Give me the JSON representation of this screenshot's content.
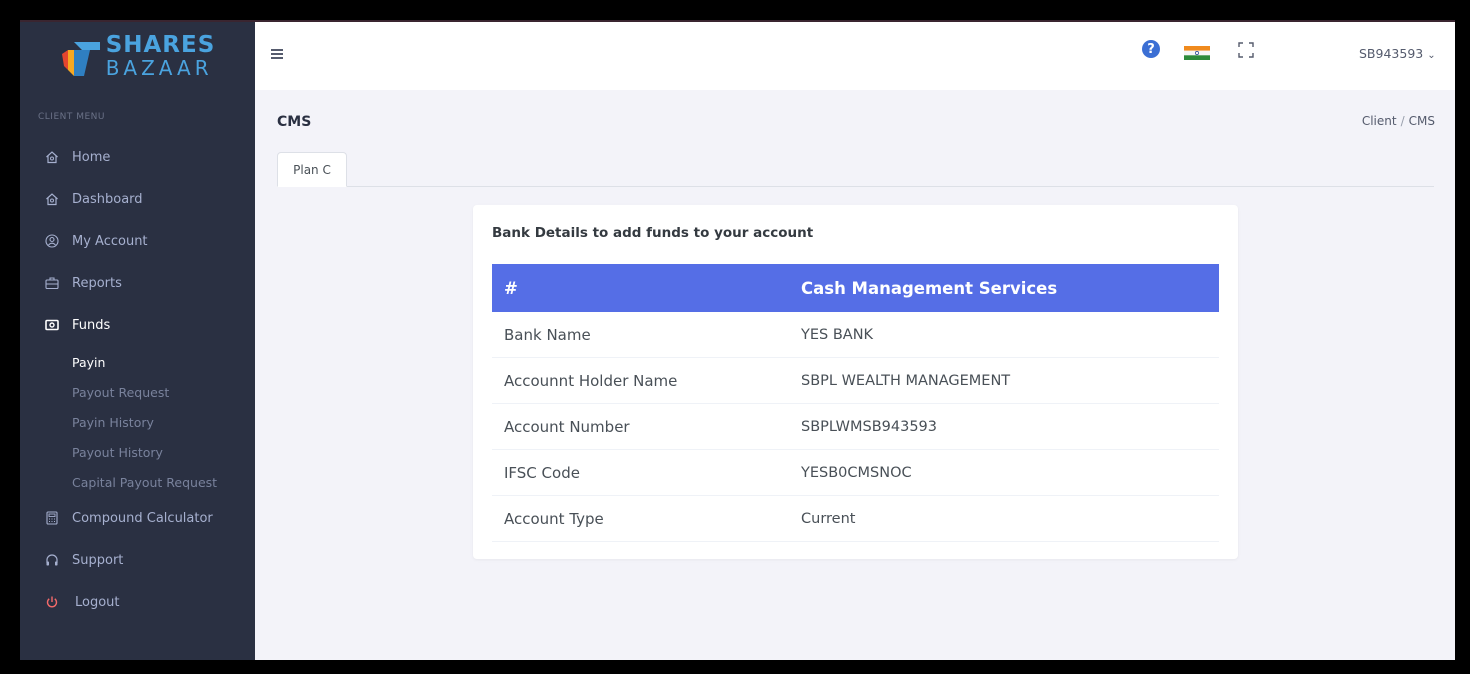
{
  "brand": {
    "line1": "SHARES",
    "line2": "BAZAAR"
  },
  "sidebar": {
    "menu_title": "CLIENT MENU",
    "items": [
      {
        "label": "Home",
        "icon": "home-icon"
      },
      {
        "label": "Dashboard",
        "icon": "home-icon"
      },
      {
        "label": "My Account",
        "icon": "user-circle-icon"
      },
      {
        "label": "Reports",
        "icon": "briefcase-icon"
      },
      {
        "label": "Funds",
        "icon": "money-icon"
      },
      {
        "label": "Compound Calculator",
        "icon": "calculator-icon"
      },
      {
        "label": "Support",
        "icon": "headphones-icon"
      },
      {
        "label": "Logout",
        "icon": "power-icon"
      }
    ],
    "sub_items": [
      {
        "label": "Payin"
      },
      {
        "label": "Payout Request"
      },
      {
        "label": "Payin History"
      },
      {
        "label": "Payout History"
      },
      {
        "label": "Capital Payout Request"
      }
    ]
  },
  "topbar": {
    "user": "SB943593",
    "help_icon": "question-circle-icon",
    "flag_icon": "india-flag-icon",
    "fullscreen_icon": "fullscreen-icon"
  },
  "page": {
    "title": "CMS",
    "breadcrumb": [
      "Client",
      "CMS"
    ],
    "breadcrumb_sep": "/",
    "tab": "Plan C"
  },
  "card": {
    "title": "Bank Details to add funds to your account",
    "columns": [
      "#",
      "Cash Management Services"
    ],
    "rows": [
      [
        "Bank Name",
        "YES BANK"
      ],
      [
        "Accounnt Holder Name",
        "SBPL WEALTH MANAGEMENT"
      ],
      [
        "Account Number",
        "SBPLWMSB943593"
      ],
      [
        "IFSC Code",
        "YESB0CMSNOC"
      ],
      [
        "Account Type",
        "Current"
      ]
    ]
  },
  "colors": {
    "sidebar": "#2a3042",
    "header": "#556ee6",
    "brand": "#4aa3df",
    "logout": "#f46a6a"
  }
}
